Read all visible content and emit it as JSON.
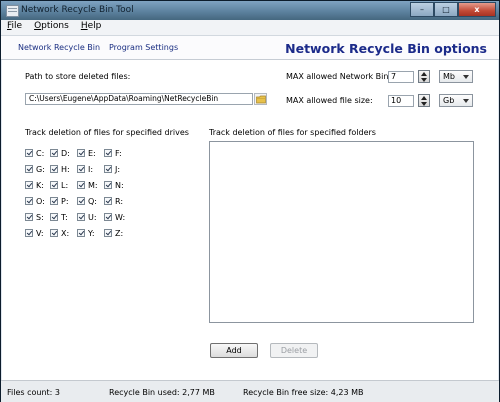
{
  "window": {
    "title": "Network Recycle Bin Tool",
    "minimize": "–",
    "maximize": "□",
    "close": "x"
  },
  "menu": [
    {
      "label": "File",
      "mnemonic": "F",
      "rest": "ile"
    },
    {
      "label": "Options",
      "mnemonic": "O",
      "rest": "ptions"
    },
    {
      "label": "Help",
      "mnemonic": "H",
      "rest": "elp"
    }
  ],
  "header": {
    "tabs": [
      "Network Recycle Bin",
      "Program Settings"
    ],
    "title": "Network Recycle Bin options"
  },
  "settings": {
    "path_label": "Path to store deleted files:",
    "path_value": "C:\\Users\\Eugene\\AppData\\Roaming\\NetRecycleBin",
    "max_bin_label": "MAX allowed Network Bin size:",
    "max_bin_value": "7",
    "max_bin_unit": "Mb",
    "max_file_label": "MAX allowed file size:",
    "max_file_value": "10",
    "max_file_unit": "Gb"
  },
  "drives": {
    "label": "Track deletion of files for specified drives",
    "rows": [
      [
        "C:",
        "D:",
        "E:",
        "F:"
      ],
      [
        "G:",
        "H:",
        "I:",
        "J:"
      ],
      [
        "K:",
        "L:",
        "M:",
        "N:"
      ],
      [
        "O:",
        "P:",
        "Q:",
        "R:"
      ],
      [
        "S:",
        "T:",
        "U:",
        "W:"
      ],
      [
        "V:",
        "X:",
        "Y:",
        "Z:"
      ]
    ]
  },
  "folders": {
    "label": "Track deletion of files for specified folders"
  },
  "buttons": {
    "add": "Add",
    "delete": "Delete"
  },
  "status": {
    "files_count": "Files count: 3",
    "bin_used": "Recycle Bin used: 2,77 MB",
    "bin_free": "Recycle Bin free size: 4,23 MB"
  },
  "colors": {
    "title_blue": "#1c2b8a",
    "titlebar": "#5d829f",
    "close_red": "#c24a36"
  }
}
